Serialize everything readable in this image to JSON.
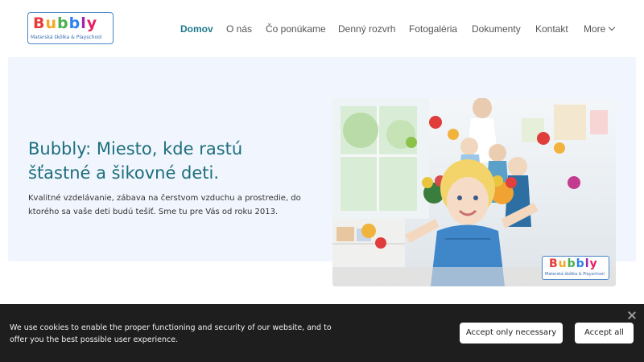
{
  "brand": {
    "logo_word": [
      "B",
      "u",
      "b",
      "b",
      "l",
      "y"
    ],
    "logo_tagline": "Materská škôlka & Playschool"
  },
  "nav": {
    "items": [
      {
        "label": "Domov",
        "active": true
      },
      {
        "label": "O nás",
        "active": false
      },
      {
        "label": "Čo ponúkame",
        "active": false
      },
      {
        "label": "Denný rozvrh",
        "active": false
      },
      {
        "label": "Fotogaléria",
        "active": false
      },
      {
        "label": "Dokumenty",
        "active": false
      },
      {
        "label": "Kontakt",
        "active": false
      }
    ],
    "more_label": "More"
  },
  "hero": {
    "title": "Bubbly: Miesto, kde rastú šťastné a šikovné deti.",
    "text": "Kvalitné vzdelávanie, zábava na čerstvom vzduchu a prostredie, do ktorého sa vaše deti budú tešiť. Sme tu pre Vás od roku 2013."
  },
  "cookie": {
    "text": "We use cookies to enable the proper functioning and security of our website, and to offer you the best possible user experience.",
    "accept_necessary_label": "Accept only necessary",
    "accept_all_label": "Accept all"
  },
  "colors": {
    "accent": "#1f7a8c",
    "hero_bg": "#f1f5fd",
    "cookie_bg": "#1e1e1e"
  }
}
